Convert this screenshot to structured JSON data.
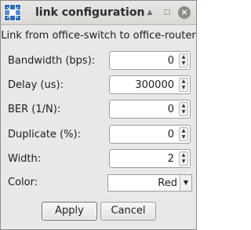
{
  "window": {
    "title": "link configuration",
    "controls": {
      "shade": "▲",
      "maximize": "□",
      "close": "×"
    }
  },
  "dialog": {
    "heading": "Link from office-switch to office-router",
    "fields": [
      {
        "label": "Bandwidth (bps):",
        "value": "0"
      },
      {
        "label": "Delay (us):",
        "value": "300000"
      },
      {
        "label": "BER (1/N):",
        "value": "0"
      },
      {
        "label": "Duplicate (%):",
        "value": "0"
      },
      {
        "label": "Width:",
        "value": "2"
      }
    ],
    "color": {
      "label": "Color:",
      "value": "Red"
    },
    "buttons": {
      "apply": "Apply",
      "cancel": "Cancel"
    }
  },
  "icons": {
    "app": "imunes-icon",
    "spin_up": "▲",
    "spin_down": "▼",
    "dropdown": "▼"
  },
  "colors": {
    "app_icon_blue": "#2f6db5",
    "window_bg": "#e9e8e6"
  }
}
